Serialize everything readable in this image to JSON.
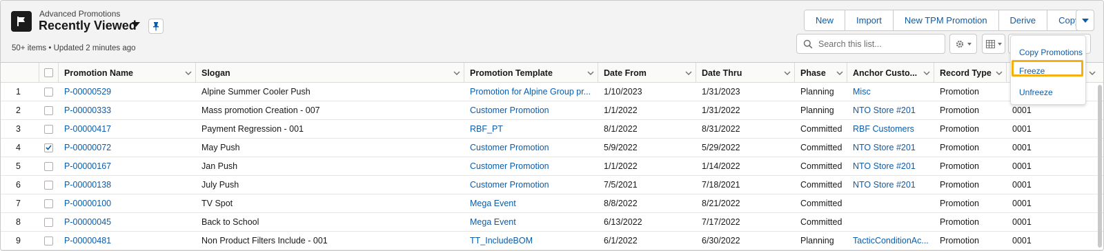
{
  "header": {
    "object_label": "Advanced Promotions",
    "list_title": "Recently Viewed",
    "meta": "50+ items • Updated 2 minutes ago"
  },
  "actions": [
    "New",
    "Import",
    "New TPM Promotion",
    "Derive",
    "Copy"
  ],
  "search": {
    "placeholder": "Search this list..."
  },
  "dropdown": {
    "items": [
      "Copy Promotions",
      "Freeze",
      "Unfreeze"
    ],
    "highlighted": "Freeze"
  },
  "table": {
    "columns": [
      "Promotion Name",
      "Slogan",
      "Promotion Template",
      "Date From",
      "Date Thru",
      "Phase",
      "Anchor Custo...",
      "Record Type"
    ],
    "rows": [
      {
        "num": "1",
        "checked": false,
        "name": "P-00000529",
        "slogan": "Alpine Summer Cooler Push",
        "template": "Promotion for Alpine Group pr...",
        "from": "1/10/2023",
        "thru": "1/31/2023",
        "phase": "Planning",
        "anchor": "Misc",
        "record_type": "Promotion",
        "extra": ""
      },
      {
        "num": "2",
        "checked": false,
        "name": "P-00000333",
        "slogan": "Mass promotion Creation - 007",
        "template": "Customer Promotion",
        "from": "1/1/2022",
        "thru": "1/31/2022",
        "phase": "Planning",
        "anchor": "NTO Store #201",
        "record_type": "Promotion",
        "extra": "0001"
      },
      {
        "num": "3",
        "checked": false,
        "name": "P-00000417",
        "slogan": "Payment Regression - 001",
        "template": "RBF_PT",
        "from": "8/1/2022",
        "thru": "8/31/2022",
        "phase": "Committed",
        "anchor": "RBF Customers",
        "record_type": "Promotion",
        "extra": "0001"
      },
      {
        "num": "4",
        "checked": true,
        "name": "P-00000072",
        "slogan": "May Push",
        "template": "Customer Promotion",
        "from": "5/9/2022",
        "thru": "5/29/2022",
        "phase": "Committed",
        "anchor": "NTO Store #201",
        "record_type": "Promotion",
        "extra": "0001"
      },
      {
        "num": "5",
        "checked": false,
        "name": "P-00000167",
        "slogan": "Jan Push",
        "template": "Customer Promotion",
        "from": "1/1/2022",
        "thru": "1/14/2022",
        "phase": "Committed",
        "anchor": "NTO Store #201",
        "record_type": "Promotion",
        "extra": "0001"
      },
      {
        "num": "6",
        "checked": false,
        "name": "P-00000138",
        "slogan": "July Push",
        "template": "Customer Promotion",
        "from": "7/5/2021",
        "thru": "7/18/2021",
        "phase": "Committed",
        "anchor": "NTO Store #201",
        "record_type": "Promotion",
        "extra": "0001"
      },
      {
        "num": "7",
        "checked": false,
        "name": "P-00000100",
        "slogan": "TV Spot",
        "template": "Mega Event",
        "from": "8/8/2022",
        "thru": "8/21/2022",
        "phase": "Committed",
        "anchor": "",
        "record_type": "Promotion",
        "extra": "0001"
      },
      {
        "num": "8",
        "checked": false,
        "name": "P-00000045",
        "slogan": "Back to School",
        "template": "Mega Event",
        "from": "6/13/2022",
        "thru": "7/17/2022",
        "phase": "Committed",
        "anchor": "",
        "record_type": "Promotion",
        "extra": "0001"
      },
      {
        "num": "9",
        "checked": false,
        "name": "P-00000481",
        "slogan": "Non Product Filters Include - 001",
        "template": "TT_IncludeBOM",
        "from": "6/1/2022",
        "thru": "6/30/2022",
        "phase": "Planning",
        "anchor": "TacticConditionAc...",
        "record_type": "Promotion",
        "extra": "0001"
      }
    ]
  },
  "colors": {
    "link": "#0b5cab",
    "header_bg": "#f3f3f3",
    "highlight": "#f3b010"
  }
}
